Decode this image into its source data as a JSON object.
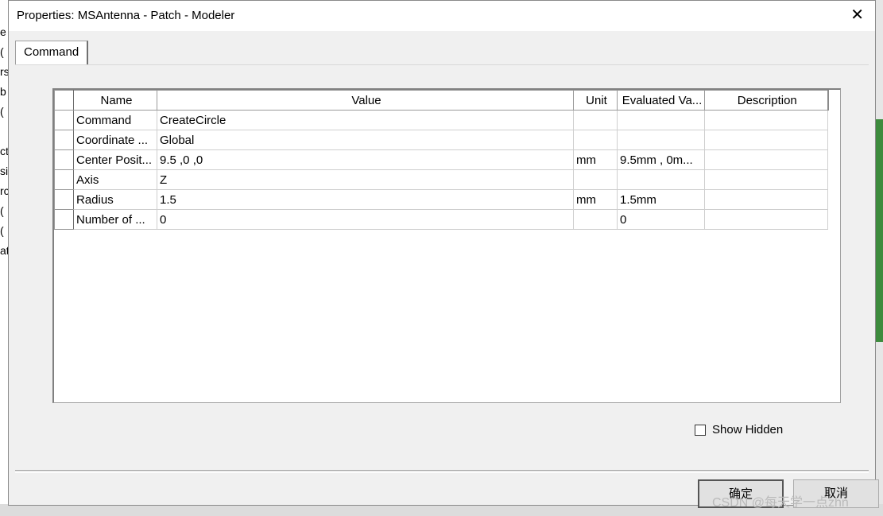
{
  "background_window": {
    "left_fragments": [
      "e",
      "(",
      "rs",
      "b",
      "(",
      "ct",
      "si",
      "rc",
      "(",
      "(",
      "at"
    ]
  },
  "dialog": {
    "title": "Properties: MSAntenna - Patch - Modeler",
    "close_glyph": "✕",
    "tab_label": "Command"
  },
  "table": {
    "columns": [
      "Name",
      "Value",
      "Unit",
      "Evaluated Va...",
      "Description"
    ],
    "rows": [
      {
        "name": "Command",
        "value": "CreateCircle",
        "unit": "",
        "evaluated": "",
        "description": ""
      },
      {
        "name": "Coordinate ...",
        "value": "Global",
        "unit": "",
        "evaluated": "",
        "description": ""
      },
      {
        "name": "Center Posit...",
        "value": "9.5 ,0 ,0",
        "unit": "mm",
        "evaluated": "9.5mm , 0m...",
        "description": ""
      },
      {
        "name": "Axis",
        "value": "Z",
        "unit": "",
        "evaluated": "",
        "description": ""
      },
      {
        "name": "Radius",
        "value": "1.5",
        "unit": "mm",
        "evaluated": "1.5mm",
        "description": ""
      },
      {
        "name": "Number of ...",
        "value": "0",
        "unit": "",
        "evaluated": "0",
        "description": ""
      }
    ]
  },
  "show_hidden": {
    "label": "Show Hidden",
    "checked": false
  },
  "buttons": {
    "ok": "确定",
    "cancel": "取消"
  },
  "watermark": "CSDN @每天学一点zhn"
}
